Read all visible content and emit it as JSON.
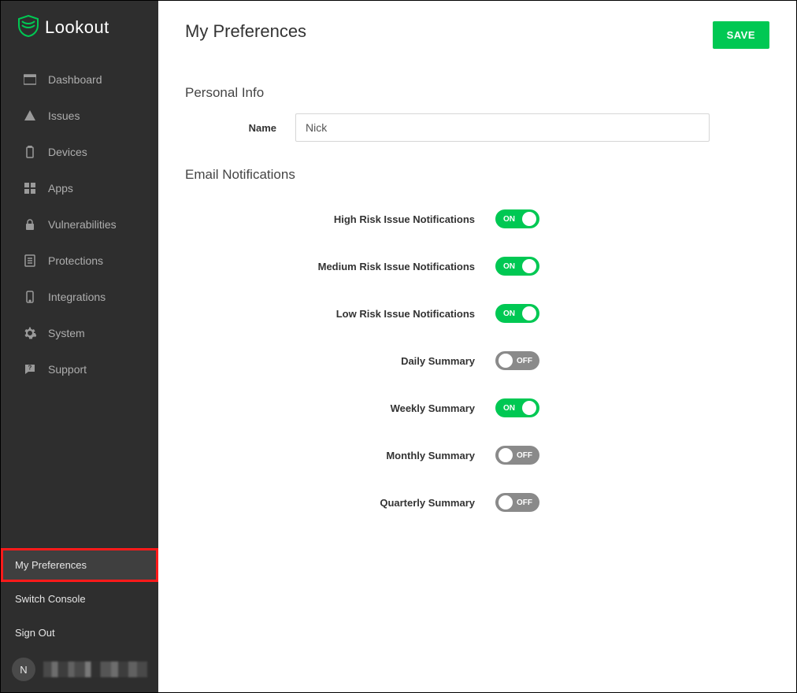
{
  "brand": {
    "name": "Lookout"
  },
  "sidebar": {
    "items": [
      {
        "label": "Dashboard",
        "icon": "dashboard-icon"
      },
      {
        "label": "Issues",
        "icon": "warning-icon"
      },
      {
        "label": "Devices",
        "icon": "battery-icon"
      },
      {
        "label": "Apps",
        "icon": "apps-icon"
      },
      {
        "label": "Vulnerabilities",
        "icon": "lock-icon"
      },
      {
        "label": "Protections",
        "icon": "list-icon"
      },
      {
        "label": "Integrations",
        "icon": "phone-icon"
      },
      {
        "label": "System",
        "icon": "gear-icon"
      },
      {
        "label": "Support",
        "icon": "help-icon"
      }
    ],
    "bottom_items": [
      {
        "label": "My Preferences",
        "active": true
      },
      {
        "label": "Switch Console",
        "active": false
      },
      {
        "label": "Sign Out",
        "active": false
      }
    ],
    "user_initial": "N"
  },
  "header": {
    "title": "My Preferences",
    "save_label": "SAVE"
  },
  "sections": {
    "personal_info_title": "Personal Info",
    "name_label": "Name",
    "name_value": "Nick",
    "email_notifications_title": "Email Notifications"
  },
  "toggle_labels": {
    "on": "ON",
    "off": "OFF"
  },
  "toggles": [
    {
      "label": "High Risk Issue Notifications",
      "on": true
    },
    {
      "label": "Medium Risk Issue Notifications",
      "on": true
    },
    {
      "label": "Low Risk Issue Notifications",
      "on": true
    },
    {
      "label": "Daily Summary",
      "on": false
    },
    {
      "label": "Weekly Summary",
      "on": true
    },
    {
      "label": "Monthly Summary",
      "on": false
    },
    {
      "label": "Quarterly Summary",
      "on": false
    }
  ]
}
